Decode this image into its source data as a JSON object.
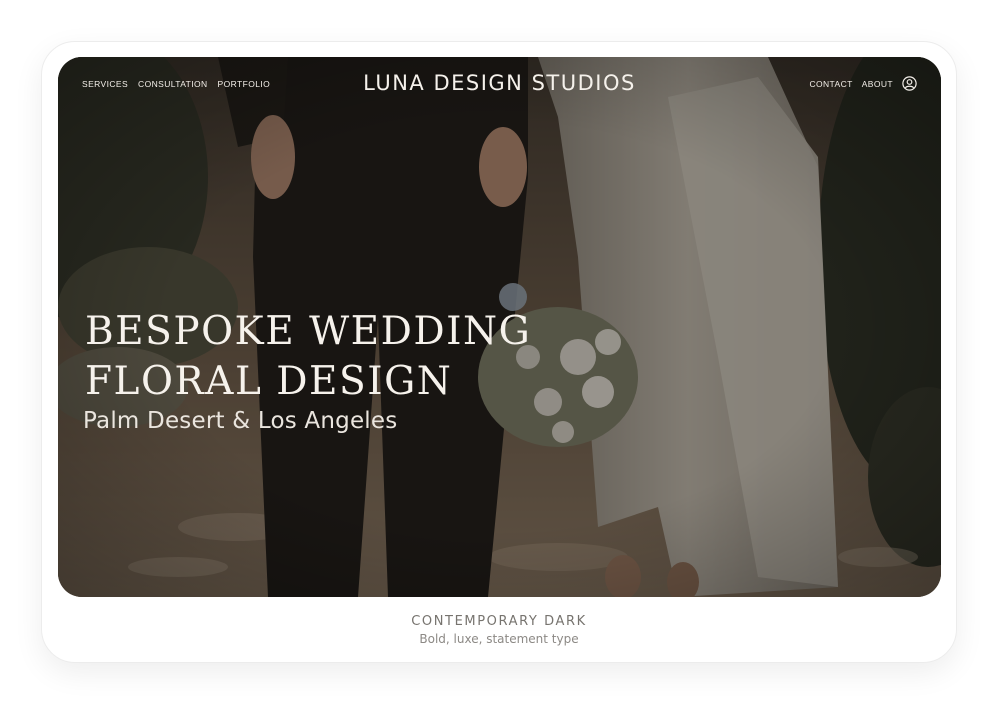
{
  "nav": {
    "left_links": [
      "SERVICES",
      "CONSULTATION",
      "PORTFOLIO"
    ],
    "brand": "LUNA DESIGN STUDIOS",
    "right_links": [
      "CONTACT",
      "ABOUT"
    ],
    "account_icon": "user-circle-icon"
  },
  "hero": {
    "headline_line1": "BESPOKE WEDDING",
    "headline_line2": "FLORAL DESIGN",
    "subheadline": "Palm Desert & Los Angeles",
    "photo_description_icon": "wedding-couple-photo"
  },
  "caption": {
    "title": "CONTEMPORARY DARK",
    "subtitle": "Bold, luxe, statement type"
  },
  "colors": {
    "overlay": "#1e1a16",
    "text_light": "#f5f1eb",
    "caption_title": "#77746f",
    "caption_sub": "#8c8985"
  }
}
